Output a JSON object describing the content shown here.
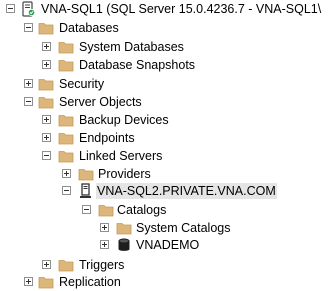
{
  "object_explorer": {
    "items": [
      {
        "label": "VNA-SQL1 (SQL Server 15.0.4236.7 - VNA-SQL1\\",
        "icon": "server-icon",
        "expanded": true
      },
      {
        "label": "Databases",
        "icon": "folder-icon",
        "expanded": true
      },
      {
        "label": "System Databases",
        "icon": "folder-icon",
        "expanded": false
      },
      {
        "label": "Database Snapshots",
        "icon": "folder-icon",
        "expanded": false
      },
      {
        "label": "Security",
        "icon": "folder-icon",
        "expanded": false
      },
      {
        "label": "Server Objects",
        "icon": "folder-icon",
        "expanded": true
      },
      {
        "label": "Backup Devices",
        "icon": "folder-icon",
        "expanded": false
      },
      {
        "label": "Endpoints",
        "icon": "folder-icon",
        "expanded": false
      },
      {
        "label": "Linked Servers",
        "icon": "folder-icon",
        "expanded": true
      },
      {
        "label": "Providers",
        "icon": "folder-icon",
        "expanded": false
      },
      {
        "label": "VNA-SQL2.PRIVATE.VNA.COM",
        "icon": "linked-server-icon",
        "expanded": true,
        "selected": true
      },
      {
        "label": "Catalogs",
        "icon": "folder-icon",
        "expanded": true
      },
      {
        "label": "System Catalogs",
        "icon": "folder-icon",
        "expanded": false
      },
      {
        "label": "VNADEMO",
        "icon": "database-icon",
        "expanded": false
      },
      {
        "label": "Triggers",
        "icon": "folder-icon",
        "expanded": false
      },
      {
        "label": "Replication",
        "icon": "folder-icon",
        "expanded": false
      }
    ]
  },
  "colors": {
    "folder": "#dcb67a",
    "selection": "#e5e5e5",
    "server_status": "#22a34a"
  }
}
